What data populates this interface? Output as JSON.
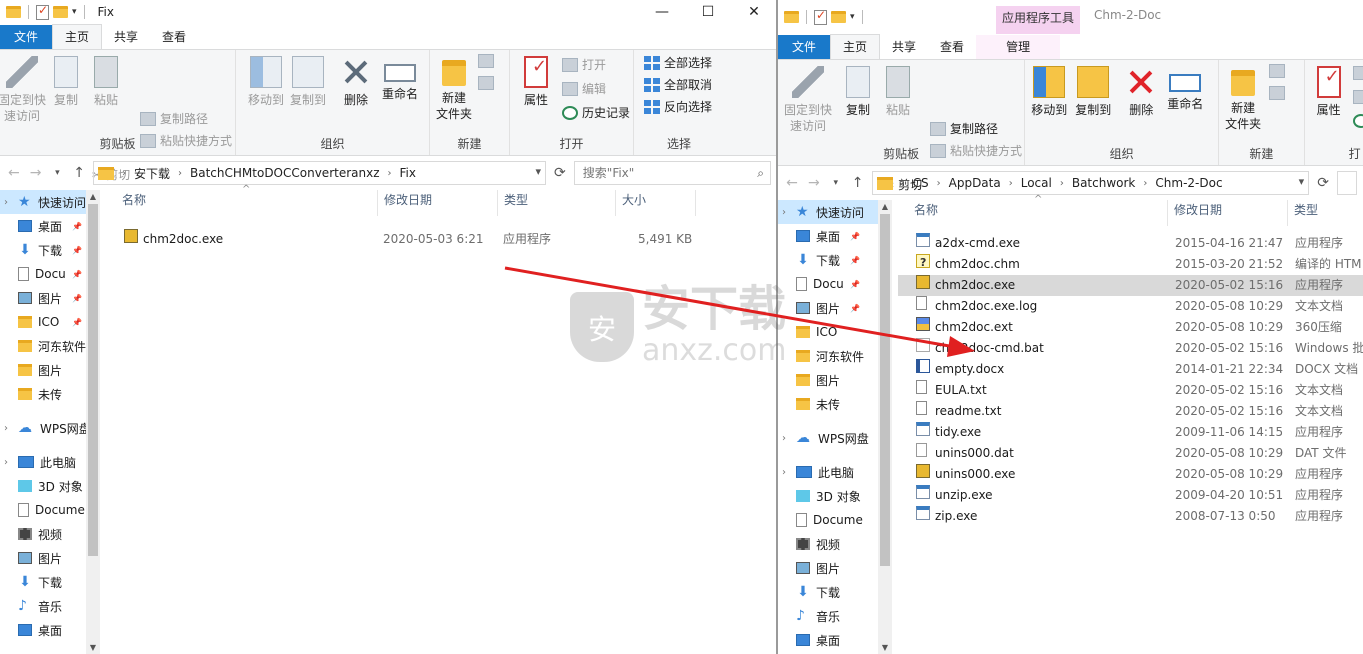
{
  "left": {
    "title": "Fix",
    "controls": {
      "minimize": "—",
      "maximize": "☐",
      "close": "✕"
    },
    "tabs": {
      "file": "文件",
      "home": "主页",
      "share": "共享",
      "view": "查看"
    },
    "ribbon": {
      "pin_quick": "固定到快\n速访问",
      "copy": "复制",
      "paste": "粘贴",
      "copy_path": "复制路径",
      "paste_shortcut": "粘贴快捷方式",
      "cut": "剪切",
      "clipboard": "剪贴板",
      "move_to": "移动到",
      "copy_to": "复制到",
      "delete": "删除",
      "rename": "重命名",
      "organize": "组织",
      "new_folder": "新建\n文件夹",
      "new_group": "新建",
      "properties": "属性",
      "open": "打开",
      "edit": "编辑",
      "history": "历史记录",
      "open_group": "打开",
      "select_all": "全部选择",
      "select_none": "全部取消",
      "invert": "反向选择",
      "select_group": "选择"
    },
    "address": [
      "安下载",
      "BatchCHMtoDOCConverteranxz",
      "Fix"
    ],
    "search_placeholder": "搜索\"Fix\"",
    "columns": {
      "name": "名称",
      "date": "修改日期",
      "type": "类型",
      "size": "大小"
    },
    "files": [
      {
        "name": "chm2doc.exe",
        "date": "2020-05-03 6:21",
        "type": "应用程序",
        "size": "5,491 KB",
        "icon": "app-icon"
      }
    ],
    "nav": [
      {
        "label": "快速访问",
        "icon": "star-icon",
        "top": true,
        "quick": true
      },
      {
        "label": "桌面",
        "icon": "desktop-icon",
        "pin": true
      },
      {
        "label": "下载",
        "icon": "download-icon",
        "pin": true
      },
      {
        "label": "Docu",
        "icon": "document-icon",
        "pin": true
      },
      {
        "label": "图片",
        "icon": "picture-icon",
        "pin": true
      },
      {
        "label": "ICO",
        "icon": "folder-icon",
        "pin": true
      },
      {
        "label": "河东软件",
        "icon": "folder-icon"
      },
      {
        "label": "图片",
        "icon": "folder-icon"
      },
      {
        "label": "未传",
        "icon": "folder-icon"
      },
      {
        "label": "",
        "icon": "",
        "spacer": true
      },
      {
        "label": "WPS网盘",
        "icon": "cloud-icon",
        "top": true
      },
      {
        "label": "",
        "icon": "",
        "spacer": true
      },
      {
        "label": "此电脑",
        "icon": "computer-icon",
        "top": true
      },
      {
        "label": "3D 对象",
        "icon": "3d-objects-icon"
      },
      {
        "label": "Docume",
        "icon": "document-icon"
      },
      {
        "label": "视频",
        "icon": "video-icon"
      },
      {
        "label": "图片",
        "icon": "picture-icon"
      },
      {
        "label": "下载",
        "icon": "download-icon"
      },
      {
        "label": "音乐",
        "icon": "music-icon"
      },
      {
        "label": "桌面",
        "icon": "desktop-icon"
      }
    ]
  },
  "right": {
    "title": "Chm-2-Doc",
    "context_tab_header": "应用程序工具",
    "tabs": {
      "file": "文件",
      "home": "主页",
      "share": "共享",
      "view": "查看",
      "manage": "管理"
    },
    "ribbon": {
      "pin_quick": "固定到快\n速访问",
      "copy": "复制",
      "paste": "粘贴",
      "copy_path": "复制路径",
      "paste_shortcut": "粘贴快捷方式",
      "cut": "剪切",
      "clipboard": "剪贴板",
      "move_to": "移动到",
      "copy_to": "复制到",
      "delete": "删除",
      "rename": "重命名",
      "organize": "组织",
      "new_folder": "新建\n文件夹",
      "new_group": "新建",
      "properties": "属性",
      "open_group": "打"
    },
    "address": [
      "CS",
      "AppData",
      "Local",
      "Batchwork",
      "Chm-2-Doc"
    ],
    "columns": {
      "name": "名称",
      "date": "修改日期",
      "type": "类型"
    },
    "files": [
      {
        "name": "a2dx-cmd.exe",
        "date": "2015-04-16 21:47",
        "type": "应用程序",
        "icon": "exe-icon"
      },
      {
        "name": "chm2doc.chm",
        "date": "2015-03-20 21:52",
        "type": "编译的 HTM",
        "icon": "chm-icon"
      },
      {
        "name": "chm2doc.exe",
        "date": "2020-05-02 15:16",
        "type": "应用程序",
        "icon": "app-icon",
        "selected": true
      },
      {
        "name": "chm2doc.exe.log",
        "date": "2020-05-08 10:29",
        "type": "文本文档",
        "icon": "text-file-icon"
      },
      {
        "name": "chm2doc.ext",
        "date": "2020-05-08 10:29",
        "type": "360压缩",
        "icon": "archive-icon"
      },
      {
        "name": "chm2doc-cmd.bat",
        "date": "2020-05-02 15:16",
        "type": "Windows 批",
        "icon": "batch-icon"
      },
      {
        "name": "empty.docx",
        "date": "2014-01-21 22:34",
        "type": "DOCX 文档",
        "icon": "docx-icon"
      },
      {
        "name": "EULA.txt",
        "date": "2020-05-02 15:16",
        "type": "文本文档",
        "icon": "text-file-icon"
      },
      {
        "name": "readme.txt",
        "date": "2020-05-02 15:16",
        "type": "文本文档",
        "icon": "text-file-icon"
      },
      {
        "name": "tidy.exe",
        "date": "2009-11-06 14:15",
        "type": "应用程序",
        "icon": "exe-icon"
      },
      {
        "name": "unins000.dat",
        "date": "2020-05-08 10:29",
        "type": "DAT 文件",
        "icon": "dat-file-icon"
      },
      {
        "name": "unins000.exe",
        "date": "2020-05-08 10:29",
        "type": "应用程序",
        "icon": "app-icon"
      },
      {
        "name": "unzip.exe",
        "date": "2009-04-20 10:51",
        "type": "应用程序",
        "icon": "exe-icon"
      },
      {
        "name": "zip.exe",
        "date": "2008-07-13 0:50",
        "type": "应用程序",
        "icon": "exe-icon"
      }
    ],
    "nav": [
      {
        "label": "快速访问",
        "icon": "star-icon",
        "top": true,
        "quick": true
      },
      {
        "label": "桌面",
        "icon": "desktop-icon",
        "pin": true
      },
      {
        "label": "下载",
        "icon": "download-icon",
        "pin": true
      },
      {
        "label": "Docu",
        "icon": "document-icon",
        "pin": true
      },
      {
        "label": "图片",
        "icon": "picture-icon",
        "pin": true
      },
      {
        "label": "ICO",
        "icon": "folder-icon"
      },
      {
        "label": "河东软件",
        "icon": "folder-icon"
      },
      {
        "label": "图片",
        "icon": "folder-icon"
      },
      {
        "label": "未传",
        "icon": "folder-icon"
      },
      {
        "label": "",
        "icon": "",
        "spacer": true
      },
      {
        "label": "WPS网盘",
        "icon": "cloud-icon",
        "top": true
      },
      {
        "label": "",
        "icon": "",
        "spacer": true
      },
      {
        "label": "此电脑",
        "icon": "computer-icon",
        "top": true
      },
      {
        "label": "3D 对象",
        "icon": "3d-objects-icon"
      },
      {
        "label": "Docume",
        "icon": "document-icon"
      },
      {
        "label": "视频",
        "icon": "video-icon"
      },
      {
        "label": "图片",
        "icon": "picture-icon"
      },
      {
        "label": "下载",
        "icon": "download-icon"
      },
      {
        "label": "音乐",
        "icon": "music-icon"
      },
      {
        "label": "桌面",
        "icon": "desktop-icon"
      }
    ]
  },
  "watermark": {
    "brand": "安下载",
    "domain": "anxz.com"
  },
  "colors": {
    "accent": "#1979ca",
    "selection": "#cce8ff",
    "annotation_arrow": "#e02020"
  }
}
